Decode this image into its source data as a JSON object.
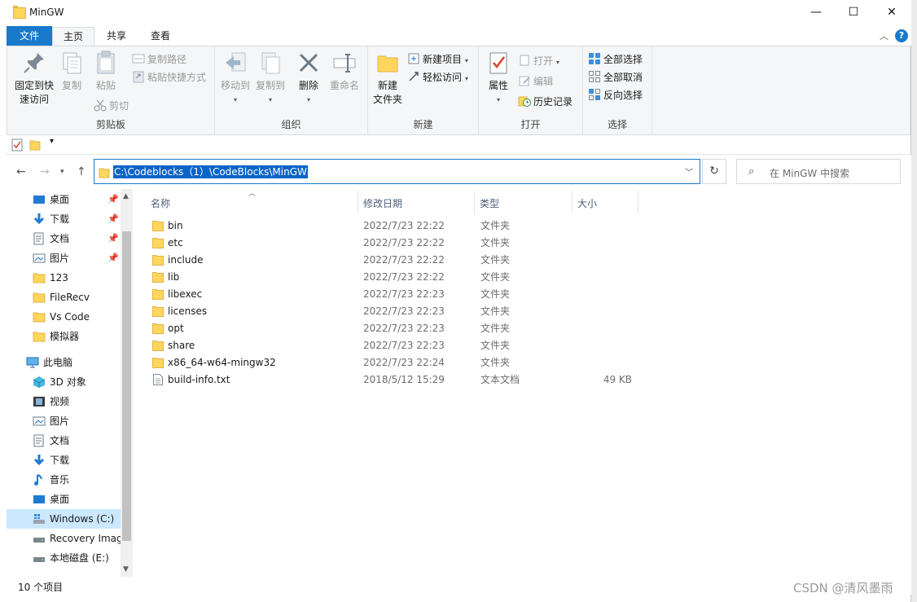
{
  "window": {
    "title": "MinGW",
    "minimize": "—",
    "maximize": "☐",
    "close": "✕"
  },
  "tabs": [
    {
      "label": "文件"
    },
    {
      "label": "主页"
    },
    {
      "label": "共享"
    },
    {
      "label": "查看"
    }
  ],
  "ribbon": {
    "clipboard": {
      "pin_label_1": "固定到快",
      "pin_label_2": "速访问",
      "copy": "复制",
      "paste": "粘贴",
      "copy_path": "复制路径",
      "paste_shortcut": "粘贴快捷方式",
      "cut": "剪切",
      "group": "剪贴板"
    },
    "organize": {
      "move_to": "移动到",
      "copy_to": "复制到",
      "delete": "删除",
      "rename": "重命名",
      "group": "组织"
    },
    "new": {
      "new_folder_1": "新建",
      "new_folder_2": "文件夹",
      "new_item": "新建项目",
      "easy_access": "轻松访问",
      "group": "新建"
    },
    "open": {
      "properties": "属性",
      "open": "打开",
      "edit": "编辑",
      "history": "历史记录",
      "group": "打开"
    },
    "select": {
      "select_all": "全部选择",
      "select_none": "全部取消",
      "invert": "反向选择",
      "group": "选择"
    }
  },
  "address": {
    "path": "C:\\Codeblocks（1）\\CodeBlocks\\MinGW",
    "search_placeholder": "在 MinGW 中搜索"
  },
  "nav": [
    {
      "label": "桌面",
      "icon": "desktop-icon",
      "pinned": true
    },
    {
      "label": "下载",
      "icon": "download-icon",
      "pinned": true
    },
    {
      "label": "文档",
      "icon": "document-icon",
      "pinned": true
    },
    {
      "label": "图片",
      "icon": "picture-icon",
      "pinned": true
    },
    {
      "label": "123",
      "icon": "folder-icon",
      "pinned": false
    },
    {
      "label": "FileRecv",
      "icon": "folder-icon",
      "pinned": false
    },
    {
      "label": "Vs Code",
      "icon": "folder-icon",
      "pinned": false
    },
    {
      "label": "模拟器",
      "icon": "folder-icon",
      "pinned": false
    },
    {
      "label": "此电脑",
      "icon": "computer-icon",
      "pinned": false
    },
    {
      "label": "3D 对象",
      "icon": "3d-objects-icon",
      "pinned": false
    },
    {
      "label": "视频",
      "icon": "video-icon",
      "pinned": false
    },
    {
      "label": "图片",
      "icon": "picture-icon",
      "pinned": false
    },
    {
      "label": "文档",
      "icon": "document-icon",
      "pinned": false
    },
    {
      "label": "下载",
      "icon": "download-icon",
      "pinned": false
    },
    {
      "label": "音乐",
      "icon": "music-icon",
      "pinned": false
    },
    {
      "label": "桌面",
      "icon": "desktop-icon",
      "pinned": false
    },
    {
      "label": "Windows (C:)",
      "icon": "drive-icon",
      "pinned": false
    },
    {
      "label": "Recovery Imag",
      "icon": "drive-icon",
      "pinned": false
    },
    {
      "label": "本地磁盘 (E:)",
      "icon": "drive-icon",
      "pinned": false
    }
  ],
  "columns": {
    "name": "名称",
    "date": "修改日期",
    "type": "类型",
    "size": "大小"
  },
  "files": [
    {
      "name": "bin",
      "date": "2022/7/23 22:22",
      "type": "文件夹",
      "size": "",
      "kind": "folder"
    },
    {
      "name": "etc",
      "date": "2022/7/23 22:22",
      "type": "文件夹",
      "size": "",
      "kind": "folder"
    },
    {
      "name": "include",
      "date": "2022/7/23 22:22",
      "type": "文件夹",
      "size": "",
      "kind": "folder"
    },
    {
      "name": "lib",
      "date": "2022/7/23 22:22",
      "type": "文件夹",
      "size": "",
      "kind": "folder"
    },
    {
      "name": "libexec",
      "date": "2022/7/23 22:23",
      "type": "文件夹",
      "size": "",
      "kind": "folder"
    },
    {
      "name": "licenses",
      "date": "2022/7/23 22:23",
      "type": "文件夹",
      "size": "",
      "kind": "folder"
    },
    {
      "name": "opt",
      "date": "2022/7/23 22:23",
      "type": "文件夹",
      "size": "",
      "kind": "folder"
    },
    {
      "name": "share",
      "date": "2022/7/23 22:23",
      "type": "文件夹",
      "size": "",
      "kind": "folder"
    },
    {
      "name": "x86_64-w64-mingw32",
      "date": "2022/7/23 22:24",
      "type": "文件夹",
      "size": "",
      "kind": "folder"
    },
    {
      "name": "build-info.txt",
      "date": "2018/5/12 15:29",
      "type": "文本文档",
      "size": "49 KB",
      "kind": "text"
    }
  ],
  "status": {
    "count": "10 个项目"
  },
  "watermark": "CSDN @清风墨雨"
}
